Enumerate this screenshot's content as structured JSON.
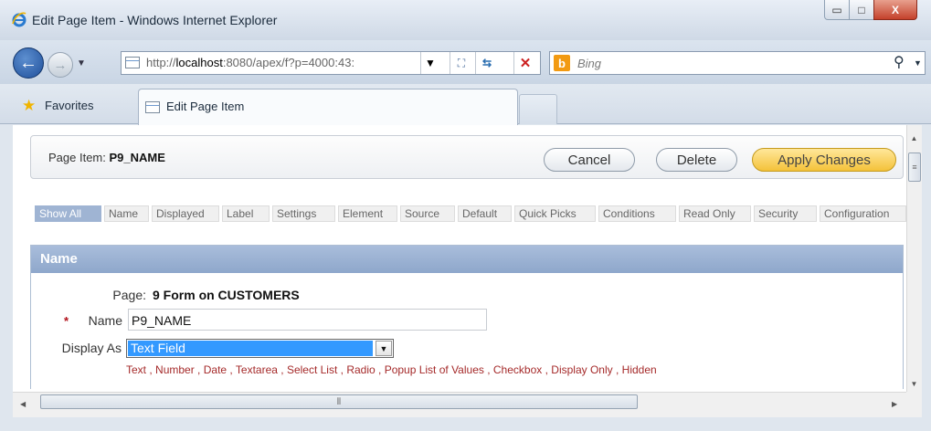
{
  "window": {
    "title": "Edit Page Item - Windows Internet Explorer",
    "min_glyph": "▭",
    "max_glyph": "□",
    "close_glyph": "X"
  },
  "nav": {
    "url_host": "http://",
    "url_bold": "localhost",
    "url_rest": ":8080/apex/f?p=4000:43:",
    "search_placeholder": "Bing"
  },
  "tabs": {
    "favorites_label": "Favorites",
    "active_tab": "Edit Page Item"
  },
  "item_bar": {
    "label_prefix": "Page Item: ",
    "item_name": "P9_NAME",
    "cancel": "Cancel",
    "delete": "Delete",
    "apply": "Apply Changes"
  },
  "section_tabs": [
    "Show All",
    "Name",
    "Displayed",
    "Label",
    "Settings",
    "Element",
    "Source",
    "Default",
    "Quick Picks",
    "Conditions",
    "Read Only",
    "Security",
    "Configuration"
  ],
  "region": {
    "title": "Name",
    "page_label": "Page:",
    "page_value": "9 Form on CUSTOMERS",
    "required_mark": "*",
    "name_label": "Name",
    "name_value": "P9_NAME",
    "display_label": "Display As",
    "display_value": "Text Field",
    "quick_picks": [
      "Text",
      "Number",
      "Date",
      "Textarea",
      "Select List",
      "Radio",
      "Popup List of Values",
      "Checkbox",
      "Display Only",
      "Hidden"
    ]
  },
  "icons": {
    "ie": "ie-logo-icon",
    "back": "back-arrow-icon",
    "forward": "forward-arrow-icon",
    "page": "page-icon",
    "compat": "compatibility-view-icon",
    "refresh": "refresh-icon",
    "stop": "stop-icon",
    "bing": "bing-icon",
    "search": "search-icon",
    "favorites": "star-icon"
  },
  "colors": {
    "region_header": "#8ea7cb",
    "apply_button": "#f4c23a",
    "quick_pick_link": "#a52a2a",
    "selected_tab": "#9fb4d3",
    "select_highlight": "#3399ff"
  }
}
